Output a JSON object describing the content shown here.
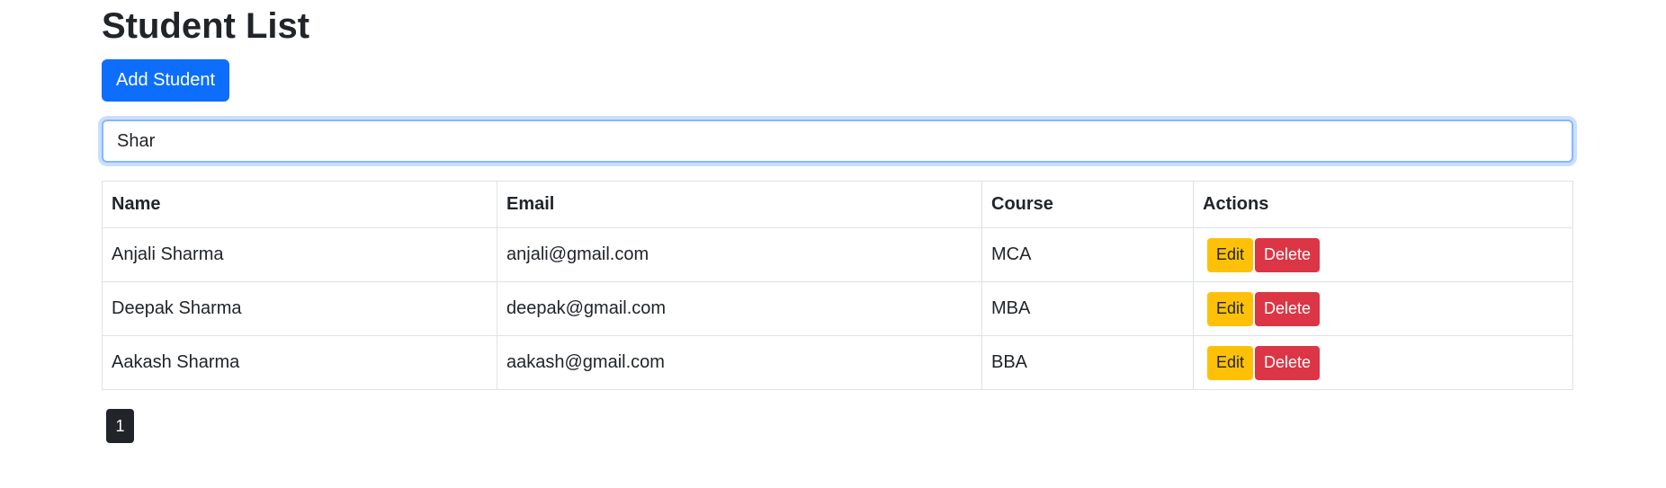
{
  "page": {
    "title": "Student List"
  },
  "toolbar": {
    "add_label": "Add Student"
  },
  "search": {
    "value": "Shar",
    "placeholder": ""
  },
  "table": {
    "headers": {
      "name": "Name",
      "email": "Email",
      "course": "Course",
      "actions": "Actions"
    },
    "rows": [
      {
        "name": "Anjali Sharma",
        "email": "anjali@gmail.com",
        "course": "MCA",
        "edit": "Edit",
        "delete": "Delete"
      },
      {
        "name": "Deepak Sharma",
        "email": "deepak@gmail.com",
        "course": "MBA",
        "edit": "Edit",
        "delete": "Delete"
      },
      {
        "name": "Aakash Sharma",
        "email": "aakash@gmail.com",
        "course": "BBA",
        "edit": "Edit",
        "delete": "Delete"
      }
    ]
  },
  "pagination": {
    "pages": [
      "1"
    ],
    "current": "1"
  },
  "colors": {
    "primary": "#0d6efd",
    "warning": "#ffc107",
    "danger": "#dc3545",
    "dark": "#212529"
  }
}
